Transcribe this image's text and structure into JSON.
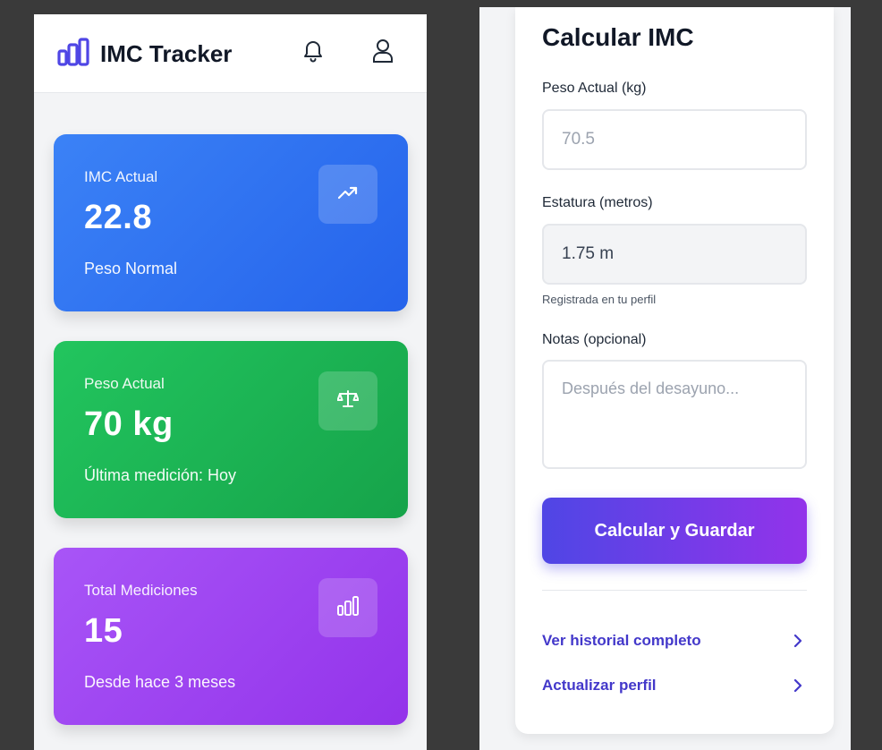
{
  "header": {
    "title": "IMC Tracker",
    "logo_icon": "bar-chart-icon",
    "notifications_icon": "bell-icon",
    "profile_icon": "user-icon"
  },
  "cards": [
    {
      "label": "IMC Actual",
      "value": "22.8",
      "sub": "Peso Normal",
      "icon": "trending-up-icon",
      "color": "#3b82f6"
    },
    {
      "label": "Peso Actual",
      "value": "70 kg",
      "sub": "Última medición: Hoy",
      "icon": "scale-icon",
      "color": "#22c55e"
    },
    {
      "label": "Total Mediciones",
      "value": "15",
      "sub": "Desde hace 3 meses",
      "icon": "bar-chart-icon",
      "color": "#a855f7"
    }
  ],
  "form": {
    "title": "Calcular IMC",
    "weight_label": "Peso Actual (kg)",
    "weight_placeholder": "70.5",
    "height_label": "Estatura (metros)",
    "height_value": "1.75 m",
    "height_hint": "Registrada en tu perfil",
    "notes_label": "Notas (opcional)",
    "notes_placeholder": "Después del desayuno...",
    "submit_label": "Calcular y Guardar"
  },
  "links": [
    {
      "label": "Ver historial completo",
      "icon": "chevron-right-icon"
    },
    {
      "label": "Actualizar perfil",
      "icon": "chevron-right-icon"
    }
  ],
  "colors": {
    "accent": "#4f46e5",
    "accent_end": "#9333ea",
    "text_dark": "#111827"
  }
}
